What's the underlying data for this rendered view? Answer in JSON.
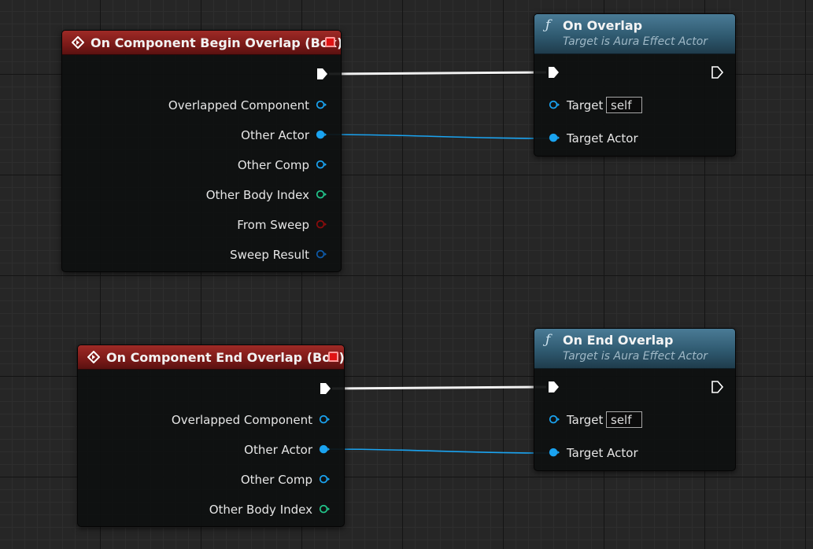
{
  "nodes": {
    "begin_overlap_event": {
      "title": "On Component Begin Overlap (Box)",
      "pins": [
        "Overlapped Component",
        "Other Actor",
        "Other Comp",
        "Other Body Index",
        "From Sweep",
        "Sweep Result"
      ]
    },
    "end_overlap_event": {
      "title": "On Component End Overlap (Box)",
      "pins": [
        "Overlapped Component",
        "Other Actor",
        "Other Comp",
        "Other Body Index"
      ]
    },
    "on_overlap_call": {
      "title": "On Overlap",
      "subtitle": "Target is Aura Effect Actor",
      "target_label": "Target",
      "target_value": "self",
      "target_actor_label": "Target Actor"
    },
    "on_end_overlap_call": {
      "title": "On End Overlap",
      "subtitle": "Target is Aura Effect Actor",
      "target_label": "Target",
      "target_value": "self",
      "target_actor_label": "Target Actor"
    }
  },
  "icons": {
    "event": "event-diamond-icon",
    "function": "function-f-icon",
    "exec_pin": "exec-arrow-icon",
    "object_pin": "object-pin-icon",
    "int_pin": "integer-pin-icon",
    "bool_pin": "boolean-pin-icon",
    "struct_pin": "struct-pin-icon",
    "stop": "event-stop-icon"
  },
  "colors": {
    "event_header": "#9e2a26",
    "function_header": "#3f6b84",
    "object_pin": "#1aa3f0",
    "integer_pin": "#22c48a",
    "boolean_pin": "#8a0c0c",
    "struct_pin": "#0e5aa8",
    "exec_wire": "#f0f0f0",
    "object_wire": "#1aa3f0"
  }
}
